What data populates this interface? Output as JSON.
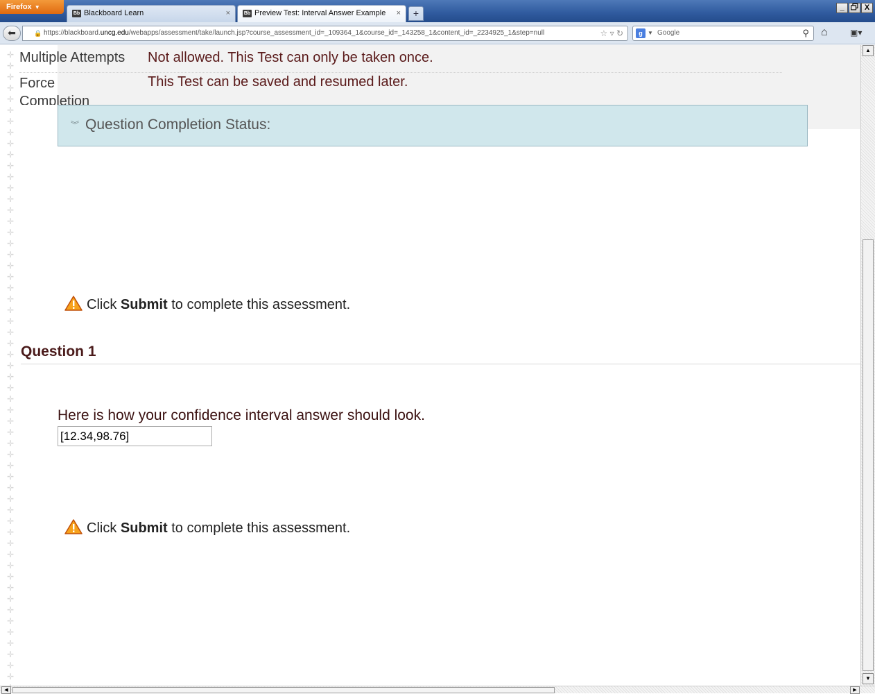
{
  "browser": {
    "menu_button": "Firefox",
    "tabs": [
      {
        "favicon": "Bb",
        "title": "Blackboard Learn",
        "close": "×"
      },
      {
        "favicon": "Bb",
        "title": "Preview Test: Interval Answer Example",
        "close": "×"
      }
    ],
    "new_tab": "+",
    "url_prefix": "https://blackboard.",
    "url_domain": "uncg.edu",
    "url_rest": "/webapps/assessment/take/launch.jsp?course_assessment_id=_109364_1&course_id=_143258_1&content_id=_2234925_1&step=null",
    "search_placeholder": "Google",
    "window_controls": [
      "_",
      "🗗",
      "X"
    ]
  },
  "test_info": {
    "multiple_attempts_label": "Multiple Attempts",
    "multiple_attempts_value": "Not allowed. This Test can only be taken once.",
    "force_completion_label": "Force Completion",
    "force_completion_value": "This Test can be saved and resumed later."
  },
  "completion_status": {
    "label": "Question Completion Status:"
  },
  "submit_notice": {
    "prefix": "Click ",
    "bold": "Submit",
    "suffix": " to complete this assessment."
  },
  "question": {
    "title": "Question 1",
    "text": "Here is how your confidence interval answer should look.",
    "answer_value": "[12.34,98.76]"
  }
}
